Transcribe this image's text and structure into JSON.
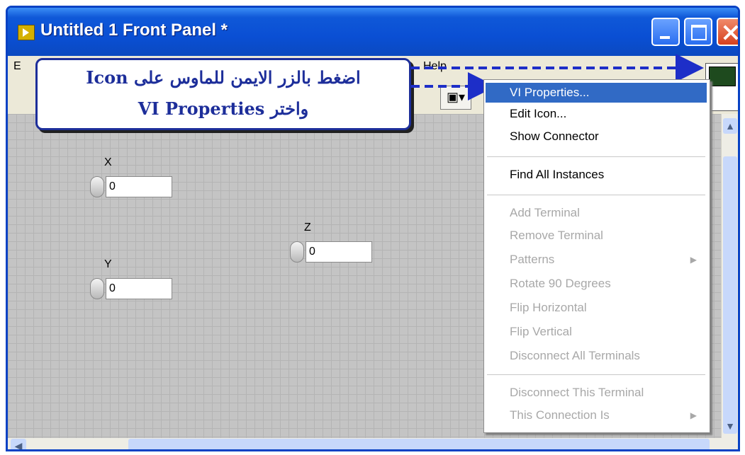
{
  "window": {
    "title": "Untitled 1 Front Panel *",
    "menu": [
      "E",
      "Help"
    ]
  },
  "callout": {
    "line1": "اضغط بالزر الايمن للماوس على Icon",
    "line2": "واختر VI Properties"
  },
  "controls": [
    {
      "label": "X",
      "value": "0"
    },
    {
      "label": "Z",
      "value": "0"
    },
    {
      "label": "Y",
      "value": "0"
    }
  ],
  "context_menu": {
    "items": [
      {
        "label": "VI Properties...",
        "state": "selected"
      },
      {
        "label": "Edit Icon...",
        "state": "enabled"
      },
      {
        "label": "Show Connector",
        "state": "enabled"
      },
      {
        "label": "Find All Instances",
        "state": "enabled"
      },
      {
        "label": "Add Terminal",
        "state": "disabled"
      },
      {
        "label": "Remove Terminal",
        "state": "disabled"
      },
      {
        "label": "Patterns",
        "state": "disabled",
        "submenu": true
      },
      {
        "label": "Rotate 90 Degrees",
        "state": "disabled"
      },
      {
        "label": "Flip Horizontal",
        "state": "disabled"
      },
      {
        "label": "Flip Vertical",
        "state": "disabled"
      },
      {
        "label": "Disconnect All Terminals",
        "state": "disabled"
      },
      {
        "label": "Disconnect This Terminal",
        "state": "disabled"
      },
      {
        "label": "This Connection Is",
        "state": "disabled",
        "submenu": true
      }
    ]
  },
  "colors": {
    "titlebar": "#0a4fd4",
    "selection": "#316ac5",
    "callout_text": "#1d2e9a",
    "arrow": "#1d2ec8"
  }
}
